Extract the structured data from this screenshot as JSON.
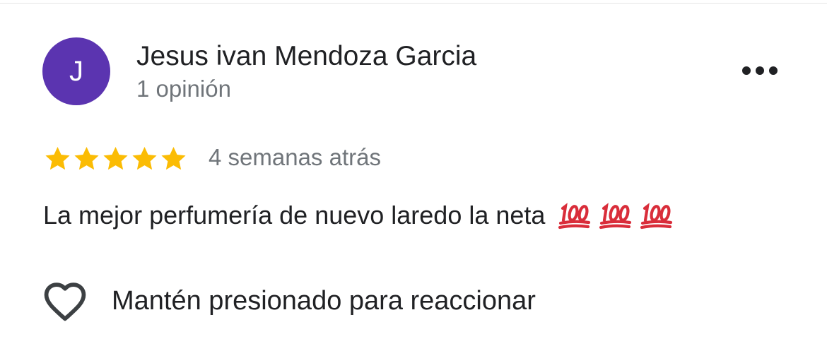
{
  "review": {
    "author": {
      "initial": "J",
      "name": "Jesus ivan Mendoza Garcia",
      "review_count": "1 opinión",
      "avatar_color": "#5b34b0"
    },
    "rating": {
      "stars": 5,
      "max": 5,
      "star_color": "#fbbc04"
    },
    "date": "4 semanas atrás",
    "text": "La mejor perfumería de nuevo laredo la neta",
    "emojis": [
      "hundred-points-emoji",
      "hundred-points-emoji",
      "hundred-points-emoji"
    ],
    "more_icon": "more-horizontal-icon"
  },
  "reaction": {
    "icon": "heart-outline-icon",
    "label": "Mantén presionado para reaccionar"
  }
}
